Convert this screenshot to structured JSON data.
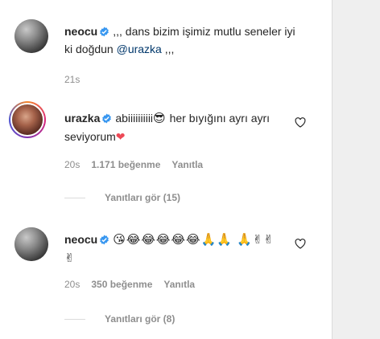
{
  "comments": [
    {
      "username": "neocu",
      "text": ",,, dans bizim işimiz mutlu seneler iyi ki doğdun",
      "mention": "@urazka",
      "text_after": ",,,",
      "time": "21s"
    },
    {
      "username": "urazka",
      "text": "abiiiiiiiiii",
      "emoji1": "😎",
      "text2": "her bıyığını ayrı ayrı seviyorum",
      "emoji2": "❤",
      "time": "20s",
      "likes": "1.171 beğenme",
      "reply": "Yanıtla",
      "view_replies": "Yanıtları gör (15)"
    },
    {
      "username": "neocu",
      "emojis": "😘😂😂😂😂😂🙏🙏 🙏✌✌✌",
      "time": "20s",
      "likes": "350 beğenme",
      "reply": "Yanıtla",
      "view_replies": "Yanıtları gör (8)"
    }
  ],
  "colors": {
    "verified": "#3897f0",
    "heart": "#ed4956",
    "mention": "#00376b"
  }
}
